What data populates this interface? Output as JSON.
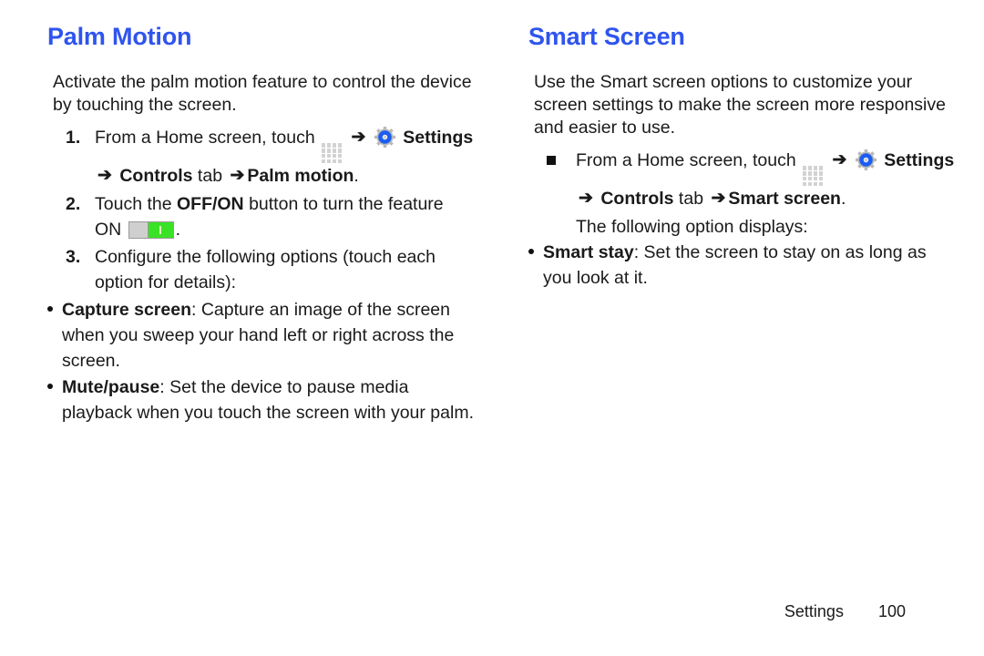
{
  "left": {
    "title": "Palm Motion",
    "intro": "Activate the palm motion feature to control the device by touching the screen.",
    "steps": [
      {
        "num": "1.",
        "pre": "From a Home screen, touch",
        "apps_icon": "apps-grid-icon",
        "settings_label": "Settings",
        "tail_bold_1": "Controls",
        "tail_mid": " tab ",
        "tail_bold_2": "Palm motion",
        "tail_end": "."
      },
      {
        "num": "2.",
        "text_a": "Touch the ",
        "bold": "OFF/ON",
        "text_b": " button to turn the feature",
        "text_c": "ON",
        "toggle_state": "on",
        "text_d": "."
      },
      {
        "num": "3.",
        "text": "Configure the following options (touch each option for details):"
      }
    ],
    "options": [
      {
        "name": "Capture screen",
        "desc": ": Capture an image of the screen when you sweep your hand left or right across the screen."
      },
      {
        "name": "Mute/pause",
        "desc": ": Set the device to pause media playback when you touch the screen with your palm."
      }
    ]
  },
  "right": {
    "title": "Smart Screen",
    "intro": "Use the Smart screen options to customize your screen settings to make the screen more responsive and easier to use.",
    "bullet": {
      "pre": "From a Home screen, touch",
      "settings_label": "Settings",
      "tail_bold_1": "Controls",
      "tail_mid": " tab ",
      "tail_bold_2": "Smart screen",
      "tail_end": "."
    },
    "follow": "The following option displays:",
    "options": [
      {
        "name": "Smart stay",
        "desc": ": Set the screen to stay on as long as you look at it."
      }
    ]
  },
  "footer": {
    "section": "Settings",
    "page": "100"
  },
  "glyphs": {
    "arrow": "➔"
  },
  "colors": {
    "heading_blue": "#2f54ee",
    "toggle_green": "#3ae226",
    "gear_blue": "#1b5df0"
  }
}
